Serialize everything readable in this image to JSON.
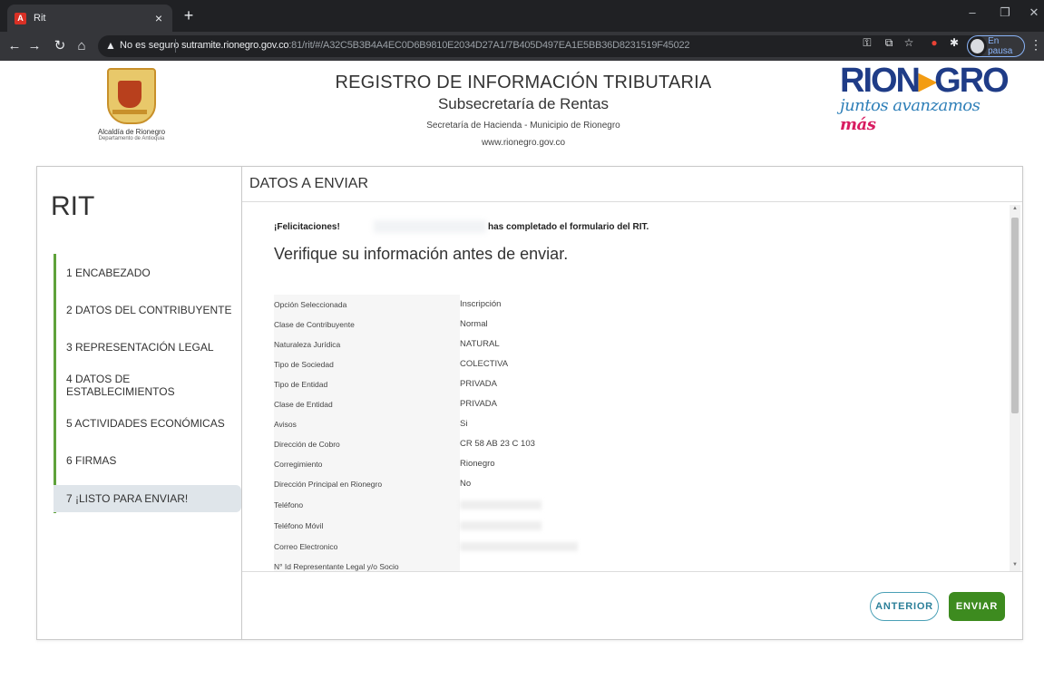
{
  "browser": {
    "tab_title": "Rit",
    "tab_favicon_letter": "A",
    "security_label": "No es seguro",
    "url_host": "sutramite.rionegro.gov.co",
    "url_rest": ":81/rit/#/A32C5B3B4A4EC0D6B9810E2034D27A1/7B405D497EA1E5BB36D8231519F45022",
    "profile_status": "En pausa"
  },
  "header": {
    "left_logo_name": "Alcaldía de Rionegro",
    "left_logo_dept": "Departamento de Antioquia",
    "title": "REGISTRO DE INFORMACIÓN TRIBUTARIA",
    "subtitle": "Subsecretaría de Rentas",
    "department": "Secretaría de Hacienda - Municipio de Rionegro",
    "website": "www.rionegro.gov.co",
    "brand_left": "RION",
    "brand_arrow": "▸",
    "brand_right": "GRO",
    "brand_tagline": "juntos avanzamos",
    "brand_tagline_em": "más"
  },
  "sidebar": {
    "title": "RIT",
    "steps": [
      {
        "label": "1 ENCABEZADO"
      },
      {
        "label": "2 DATOS DEL CONTRIBUYENTE"
      },
      {
        "label": "3 REPRESENTACIÓN LEGAL"
      },
      {
        "label": "4 DATOS DE ESTABLECIMIENTOS"
      },
      {
        "label": "5 ACTIVIDADES ECONÓMICAS"
      },
      {
        "label": "6 FIRMAS"
      },
      {
        "label": "7 ¡LISTO PARA ENVIAR!"
      }
    ],
    "active_step": 7
  },
  "main": {
    "section_title": "DATOS A ENVIAR",
    "congrats_prefix": "¡Felicitaciones!",
    "congrats_suffix": "has completado el formulario del RIT.",
    "verify_text": "Verifique su información antes de enviar.",
    "rows": [
      {
        "label": "Opción Seleccionada",
        "value": "Inscripción"
      },
      {
        "label": "Clase de Contribuyente",
        "value": "Normal"
      },
      {
        "label": "Naturaleza Jurídica",
        "value": "NATURAL"
      },
      {
        "label": "Tipo de Sociedad",
        "value": "COLECTIVA"
      },
      {
        "label": "Tipo de Entidad",
        "value": "PRIVADA"
      },
      {
        "label": "Clase de Entidad",
        "value": "PRIVADA"
      },
      {
        "label": "Avisos",
        "value": "Si"
      },
      {
        "label": "Dirección de Cobro",
        "value": "CR 58 AB 23 C 103"
      },
      {
        "label": "Corregimiento",
        "value": "Rionegro"
      },
      {
        "label": "Dirección Principal en Rionegro",
        "value": "No"
      },
      {
        "label": "Teléfono",
        "value": ""
      },
      {
        "label": "Teléfono Móvil",
        "value": ""
      },
      {
        "label": "Correo Electronico",
        "value": ""
      },
      {
        "label": "N° Id Representante Legal y/o Socio",
        "value": ""
      }
    ],
    "buttons": {
      "previous": "ANTERIOR",
      "send": "ENVIAR"
    }
  }
}
